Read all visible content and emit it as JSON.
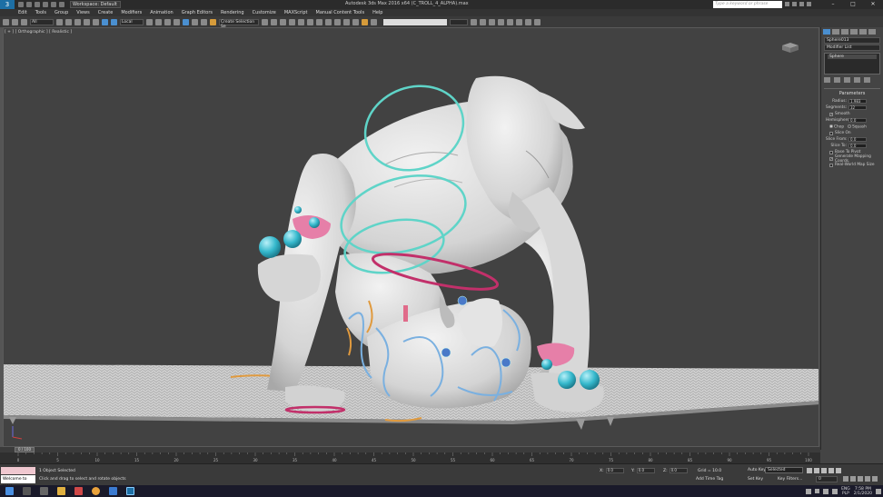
{
  "window": {
    "title": "Autodesk 3ds Max 2016 x64    (C_TROLL_4_ALPHA).max",
    "workspace": "Workspace: Default",
    "search_placeholder": "Type a keyword or phrase",
    "controls": [
      "–",
      "□",
      "✕"
    ]
  },
  "menu": [
    "Edit",
    "Tools",
    "Group",
    "Views",
    "Create",
    "Modifiers",
    "Animation",
    "Graph Editors",
    "Rendering",
    "Customize",
    "MAXScript",
    "Manual Content Tools",
    "Help"
  ],
  "toolbar": {
    "selection_filter": "All",
    "reference_coord": "Local",
    "named_selection": "Create Selection Se"
  },
  "viewport": {
    "label": "[ + ] [ Orthographic ] [ Realistic ]"
  },
  "command_panel": {
    "object_name": "Sphere013",
    "modifier_list": "Modifier List",
    "stack_item": "Sphere",
    "rollout_title": "Parameters",
    "radius_label": "Radius:",
    "radius_value": "1.983",
    "segments_label": "Segments:",
    "segments_value": "32",
    "smooth_label": "Smooth",
    "hemisphere_label": "Hemisphere:",
    "hemisphere_value": "0.0",
    "chop_label": "Chop",
    "squash_label": "Squash",
    "slice_on_label": "Slice On",
    "slice_from_label": "Slice From:",
    "slice_from_value": "0.0",
    "slice_to_label": "Slice To:",
    "slice_to_value": "0.0",
    "base_to_pivot_label": "Base To Pivot",
    "gen_mapping_label": "Generate Mapping Coords.",
    "real_world_label": "Real-World Map Size"
  },
  "timeline": {
    "frame_display": "0 / 100",
    "ticks": [
      "0",
      "5",
      "10",
      "15",
      "20",
      "25",
      "30",
      "35",
      "40",
      "45",
      "50",
      "55",
      "60",
      "65",
      "70",
      "75",
      "80",
      "85",
      "90",
      "95",
      "100"
    ]
  },
  "status": {
    "welcome": "Welcome to MAX",
    "objects_selected": "1 Object Selected",
    "prompt": "Click and drag to select and rotate objects",
    "x_label": "X:",
    "x_value": "0.0",
    "y_label": "Y:",
    "y_value": "0.0",
    "z_label": "Z:",
    "z_value": "0.0",
    "grid": "Grid = 10.0",
    "add_time_tag": "Add Time Tag",
    "auto_key": "Auto Key",
    "set_key": "Set Key",
    "selected": "Selected",
    "key_filters": "Key Filters...",
    "frame": "0"
  },
  "taskbar": {
    "lang_top": "ENG",
    "lang_bottom": "PLP",
    "time": "7:58 PM",
    "date": "2/1/2020"
  },
  "colors": {
    "accent_blue": "#4a8fd0",
    "teal_ring": "#5fd4c8",
    "pink_band": "#e67fa8",
    "magenta_ring": "#c2306a",
    "light_blue_spline": "#7ab0e0",
    "orange_spline": "#e09a3e"
  }
}
